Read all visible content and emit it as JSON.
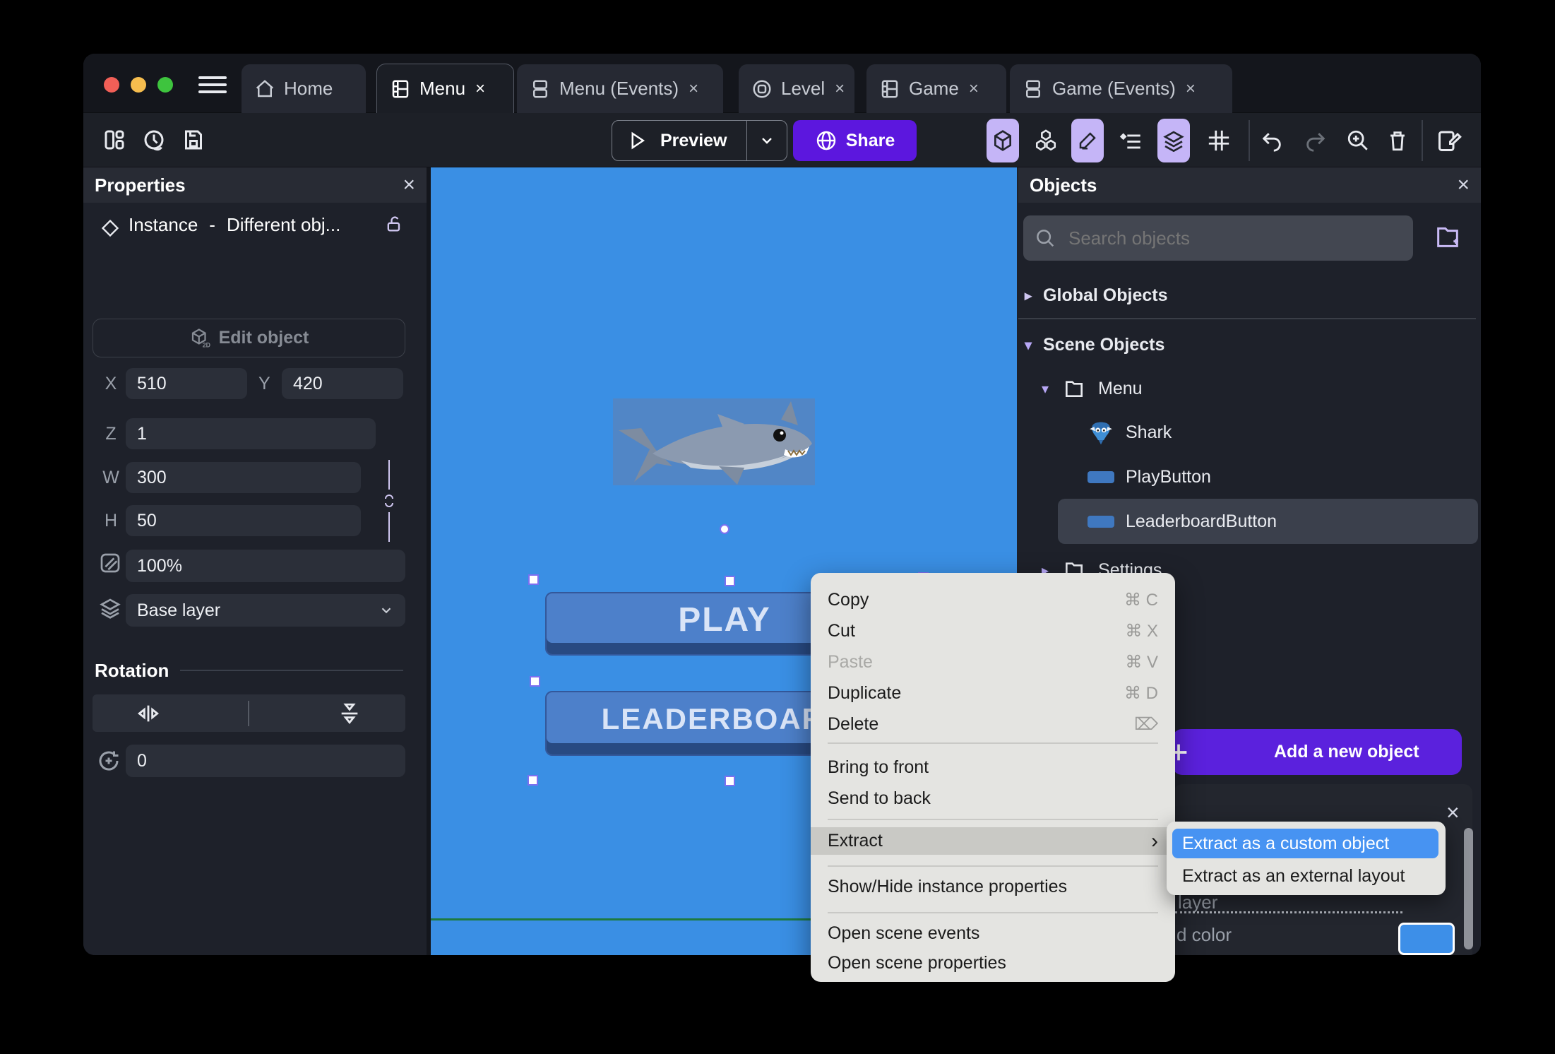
{
  "tabs": [
    {
      "label": "Home"
    },
    {
      "label": "Menu",
      "close": "×"
    },
    {
      "label": "Menu (Events)",
      "close": "×"
    },
    {
      "label": "Level",
      "close": "×"
    },
    {
      "label": "Game",
      "close": "×"
    },
    {
      "label": "Game (Events)",
      "close": "×"
    }
  ],
  "toolbar": {
    "preview": "Preview",
    "share": "Share"
  },
  "properties": {
    "title": "Properties",
    "close": "×",
    "instance_type": "Instance",
    "separator": "-",
    "instance_object": "Different obj...",
    "edit_object": "Edit object",
    "x_label": "X",
    "x_value": "510",
    "y_label": "Y",
    "y_value": "420",
    "z_label": "Z",
    "z_value": "1",
    "w_label": "W",
    "w_value": "300",
    "h_label": "H",
    "h_value": "50",
    "opacity_value": "100%",
    "layer_value": "Base layer",
    "rotation_title": "Rotation",
    "rotation_value": "0"
  },
  "canvas": {
    "play_label": "PLAY",
    "leaderboard_label": "LEADERBOARD"
  },
  "objects": {
    "title": "Objects",
    "close": "×",
    "search_placeholder": "Search objects",
    "global_label": "Global Objects",
    "scene_label": "Scene Objects",
    "tree": [
      {
        "label": "Menu"
      },
      {
        "label": "Shark"
      },
      {
        "label": "PlayButton"
      },
      {
        "label": "LeaderboardButton"
      },
      {
        "label": "Settings"
      }
    ],
    "kebab": "⋮",
    "add_button": "Add a new object",
    "panel_close": "×",
    "partial_layer_text": "layer",
    "partial_color_text": "d color"
  },
  "context_menu": {
    "items": [
      {
        "label": "Copy",
        "shortcut": "⌘ C"
      },
      {
        "label": "Cut",
        "shortcut": "⌘ X"
      },
      {
        "label": "Paste",
        "shortcut": "⌘ V"
      },
      {
        "label": "Duplicate",
        "shortcut": "⌘ D"
      },
      {
        "label": "Delete",
        "shortcut": "⌦"
      },
      {
        "label": "Bring to front"
      },
      {
        "label": "Send to back"
      },
      {
        "label": "Extract",
        "arrow": "›"
      },
      {
        "label": "Show/Hide instance properties"
      },
      {
        "label": "Open scene events"
      },
      {
        "label": "Open scene properties"
      }
    ]
  },
  "submenu": {
    "items": [
      {
        "label": "Extract as a custom object"
      },
      {
        "label": "Extract as an external layout"
      }
    ]
  },
  "colors": {
    "accent_purple": "#5b21dd",
    "canvas_blue": "#3a8fe4",
    "menu_highlight_blue": "#4793f2",
    "selection_purple": "#7e6ff0"
  }
}
